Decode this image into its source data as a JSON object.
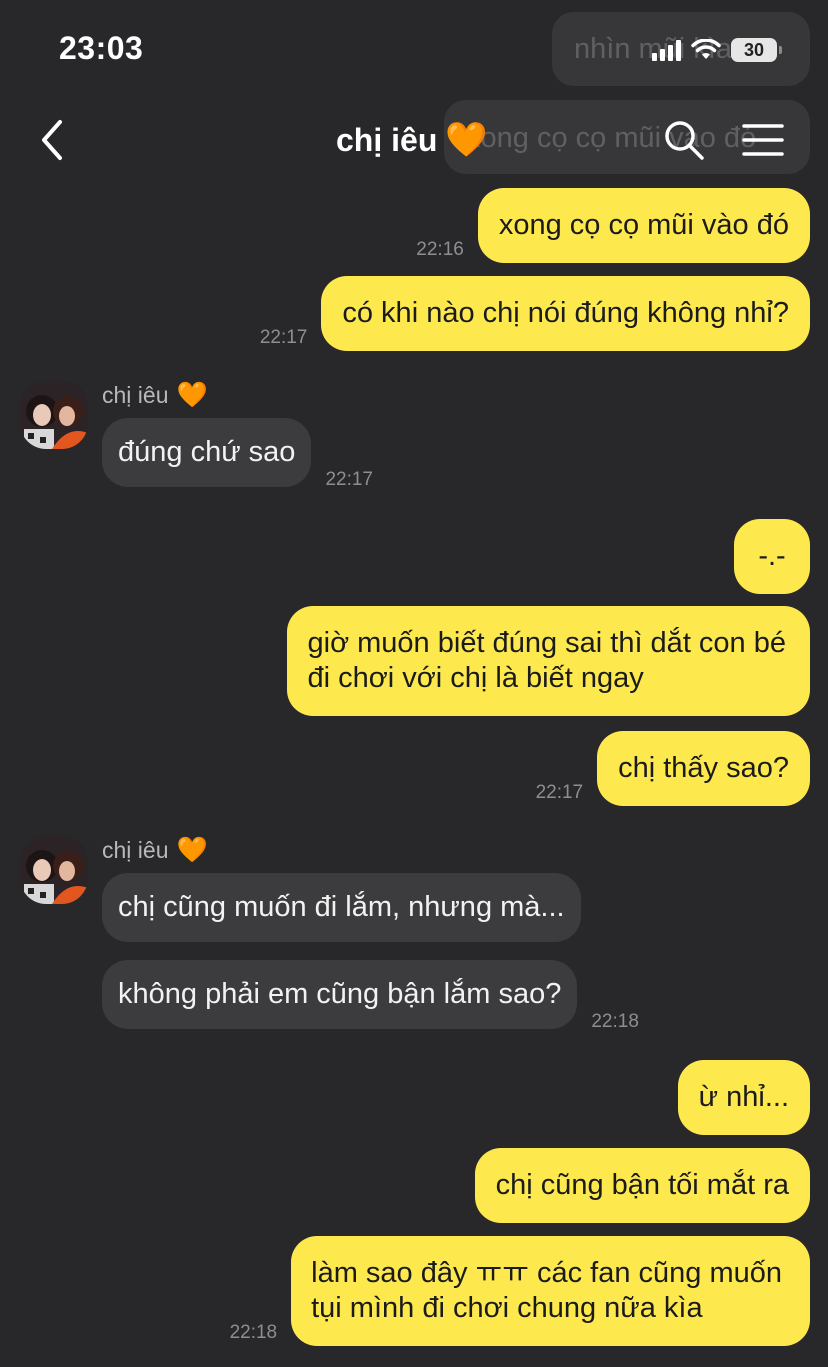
{
  "status": {
    "time": "23:03",
    "battery": "30",
    "ghost_messages": [
      "nhìn mũi kìa",
      "xong cọ cọ mũi vào đó"
    ]
  },
  "header": {
    "title": "chị iêu",
    "title_emoji": "🧡",
    "back_icon": "chevron-left-icon",
    "search_icon": "search-icon",
    "menu_icon": "hamburger-menu-icon"
  },
  "contact": {
    "name": "chị iêu",
    "emoji": "🧡"
  },
  "messages": [
    {
      "from": "me",
      "lines": [
        "xong cọ cọ mũi vào đó"
      ],
      "time": "22:16"
    },
    {
      "from": "me",
      "lines": [
        "có khi nào chị nói đúng không nhỉ?"
      ],
      "time": "22:17"
    },
    {
      "from": "them",
      "lines": [
        "đúng chứ sao"
      ],
      "time": "22:17"
    },
    {
      "from": "me",
      "lines": [
        "-.-"
      ],
      "time": ""
    },
    {
      "from": "me",
      "lines": [
        "giờ muốn biết đúng sai thì dắt con bé",
        "đi chơi với chị là biết ngay"
      ],
      "time": ""
    },
    {
      "from": "me",
      "lines": [
        "chị thấy sao?"
      ],
      "time": "22:17"
    },
    {
      "from": "them",
      "lines": [
        "chị cũng muốn đi lắm, nhưng mà..."
      ],
      "time": ""
    },
    {
      "from": "them",
      "lines": [
        "không phải em cũng bận lắm sao?"
      ],
      "time": "22:18"
    },
    {
      "from": "me",
      "lines": [
        "ừ nhỉ..."
      ],
      "time": ""
    },
    {
      "from": "me",
      "lines": [
        "chị cũng bận tối mắt ra"
      ],
      "time": ""
    },
    {
      "from": "me",
      "lines": [
        "làm sao đây ㅠㅠ các fan cũng muốn",
        "tụi mình đi chơi chung nữa kìa"
      ],
      "time": "22:18"
    }
  ],
  "colors": {
    "background": "#28282a",
    "outgoing_bubble": "#fde84e",
    "incoming_bubble": "#3c3c3e",
    "timestamp": "#8e8e91"
  }
}
